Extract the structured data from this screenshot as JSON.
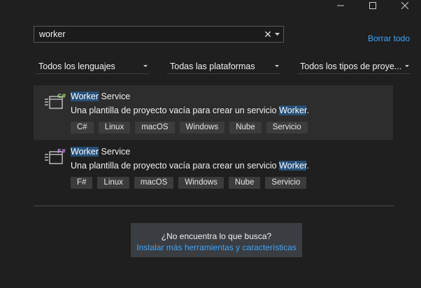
{
  "search": {
    "value": "worker",
    "clear_glyph": "✕"
  },
  "clear_all_label": "Borrar todo",
  "filters": {
    "language": "Todos los lenguajes",
    "platform": "Todas las plataformas",
    "project_type": "Todos los tipos de proye..."
  },
  "templates": [
    {
      "title_highlight": "Worker",
      "title_rest": " Service",
      "desc_prefix": "Una plantilla de proyecto vacía para crear un servicio ",
      "desc_highlight": "Worker",
      "desc_suffix": ".",
      "language_badge": "C#",
      "badge_color": "#9bd36b",
      "tags": [
        "C#",
        "Linux",
        "macOS",
        "Windows",
        "Nube",
        "Servicio"
      ]
    },
    {
      "title_highlight": "Worker",
      "title_rest": " Service",
      "desc_prefix": "Una plantilla de proyecto vacía para crear un servicio ",
      "desc_highlight": "Worker",
      "desc_suffix": ".",
      "language_badge": "F#",
      "badge_color": "#c77fe6",
      "tags": [
        "F#",
        "Linux",
        "macOS",
        "Windows",
        "Nube",
        "Servicio"
      ]
    }
  ],
  "not_found": {
    "question": "¿No encuentra lo que busca?",
    "link": "Instalar más herramientas y características"
  },
  "colors": {
    "accent_link": "#3ea6ff",
    "highlight": "#264f78",
    "background": "#1f1f1f"
  }
}
